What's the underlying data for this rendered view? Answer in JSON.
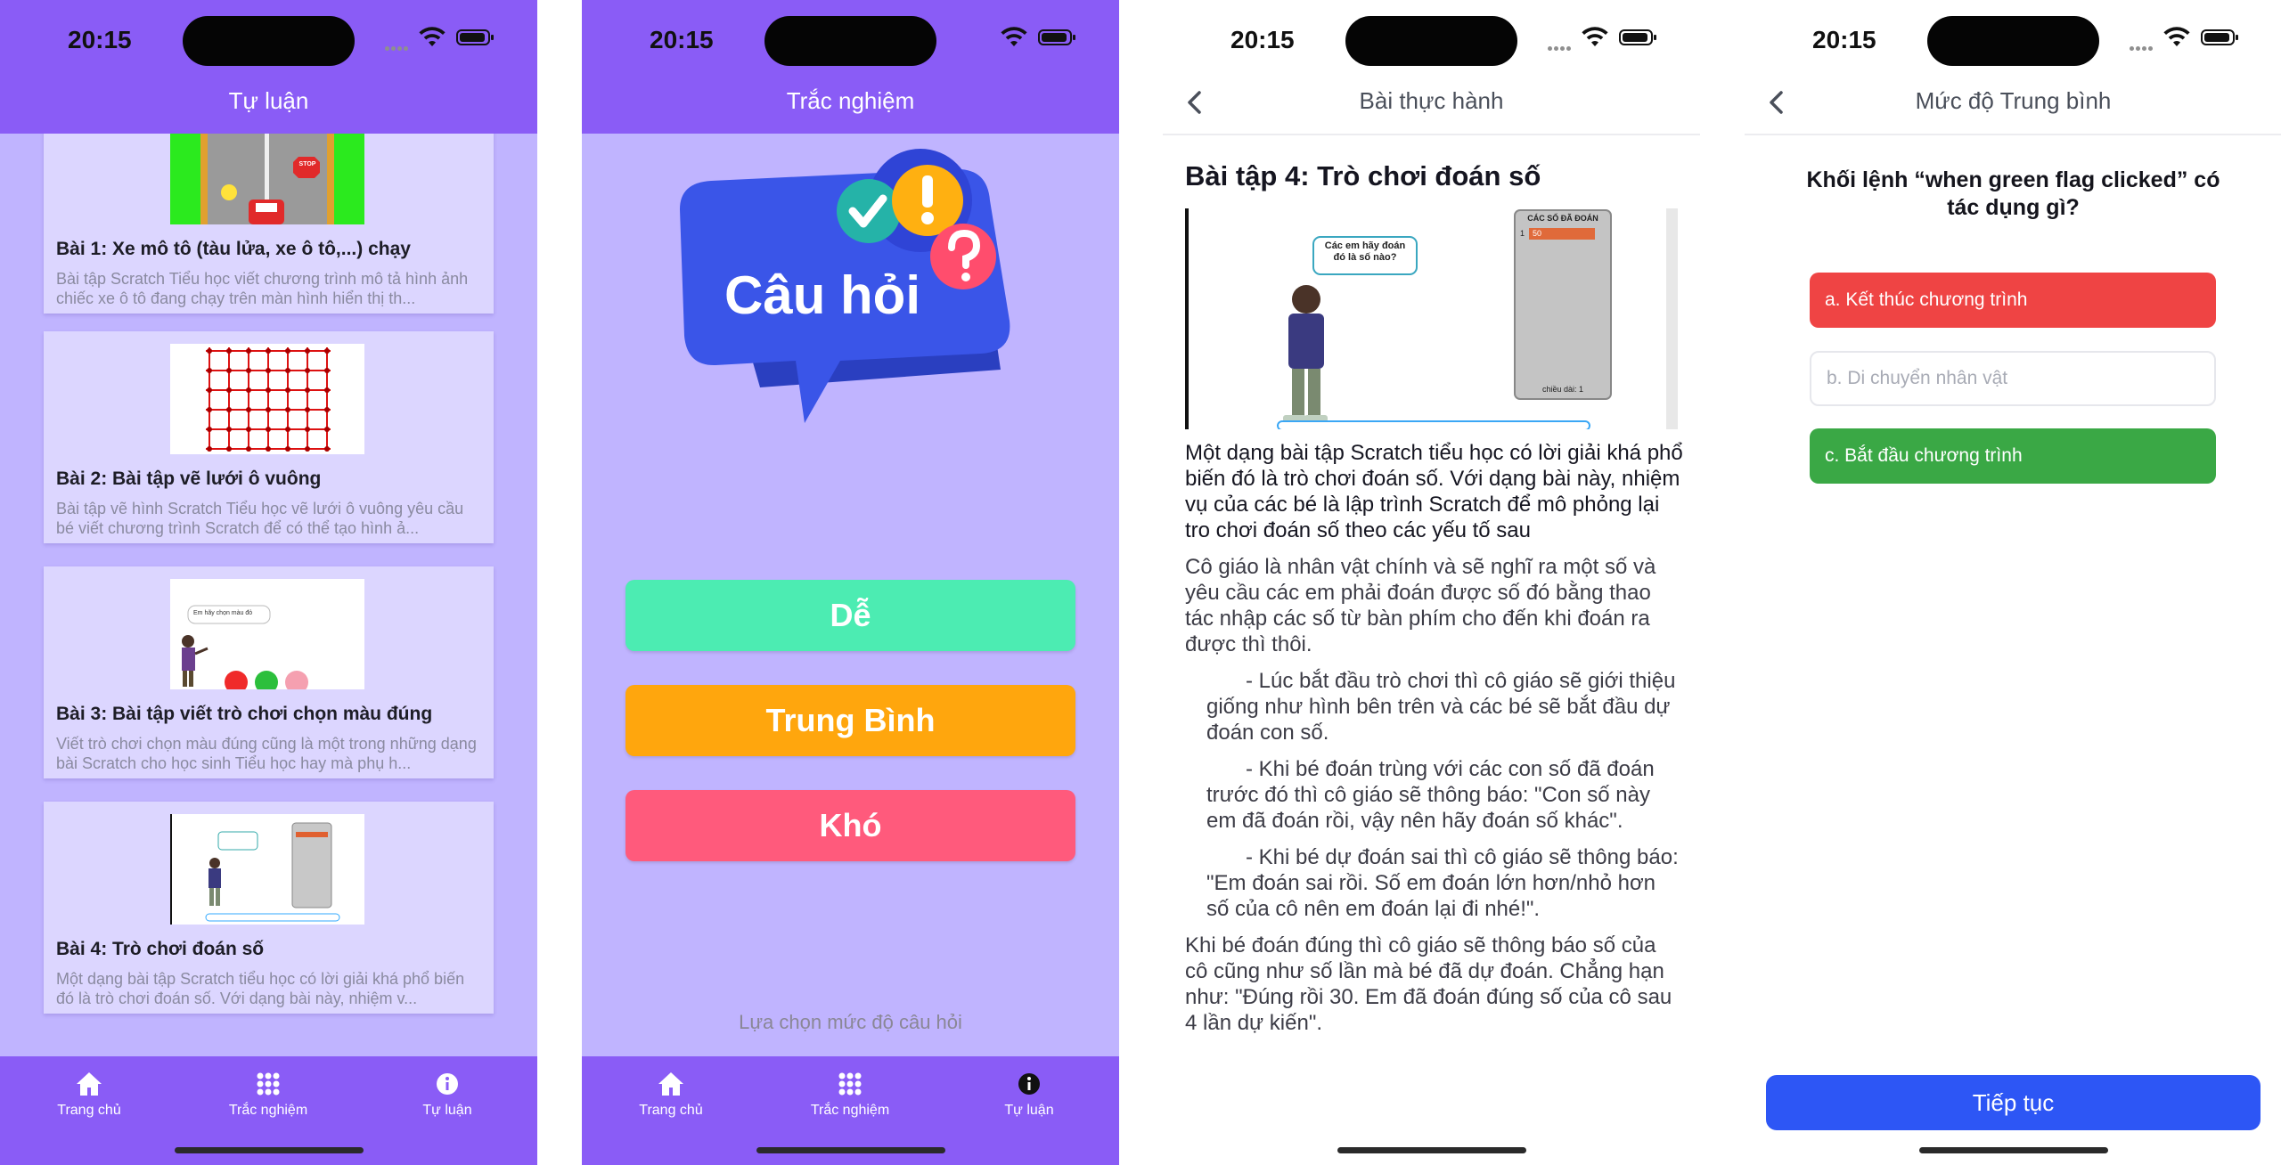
{
  "status": {
    "time": "20:15"
  },
  "screen1": {
    "title": "Tự luận",
    "cards": [
      {
        "title": "Bài 1: Xe mô tô (tàu lửa, xe ô tô,...) chạy",
        "desc": "Bài tập Scratch Tiểu học viết chương trình mô tả hình ảnh chiếc xe ô tô đang chạy trên màn hình hiển thị th...",
        "thumb_sign": "STOP"
      },
      {
        "title": "Bài 2: Bài tập vẽ lưới ô vuông",
        "desc": "Bài tập vẽ hình Scratch Tiểu học vẽ lưới ô vuông yêu cầu bé viết chương trình Scratch để có thể tạo hình ả..."
      },
      {
        "title": "Bài 3: Bài tập viết trò chơi chọn màu đúng",
        "desc": "Viết trò chơi chọn màu đúng cũng là một trong những dạng bài Scratch cho học sinh Tiểu học hay mà phụ h...",
        "thumb_speech": "Em hãy chọn màu đỏ"
      },
      {
        "title": "Bài 4: Trò chơi đoán số",
        "desc": "Một dạng bài tập Scratch tiểu học có lời giải khá phổ biến đó là trò chơi đoán số. Với dạng bài này, nhiệm v..."
      }
    ]
  },
  "tabs": [
    {
      "label": "Trang chủ",
      "icon": "home-icon"
    },
    {
      "label": "Trắc nghiệm",
      "icon": "grid-icon"
    },
    {
      "label": "Tự luận",
      "icon": "info-icon"
    }
  ],
  "screen2": {
    "title": "Trắc nghiệm",
    "bubble_text": "Câu hỏi",
    "levels": [
      {
        "label": "Dễ",
        "color": "#4cecb2"
      },
      {
        "label": "Trung Bình",
        "color": "#ffa60d"
      },
      {
        "label": "Khó",
        "color": "#ff5a7c"
      }
    ],
    "hint": "Lựa chọn mức độ câu hỏi"
  },
  "screen3": {
    "title": "Bài thực hành",
    "heading": "Bài tập 4: Trò chơi đoán số",
    "image": {
      "speech": "Các em hãy đoán đó là số nào?",
      "list_header": "CÁC SỐ ĐÃ ĐOÁN",
      "list_index": "1",
      "list_value": "50",
      "list_footer": "chiều dài: 1"
    },
    "paragraphs": [
      {
        "style": "main",
        "text": "Một dạng bài tập Scratch tiểu học có lời giải khá phổ biến đó là trò chơi đoán số. Với dạng bài này, nhiệm vụ của các bé là lập trình Scratch để mô phỏng lại tro chơi đoán số theo các yếu tố sau"
      },
      {
        "style": "grey",
        "text": "Cô giáo là nhân vật chính và sẽ nghĩ ra một số và yêu cầu các em phải đoán được số đó bằng thao tác nhập các số từ bàn phím cho đến khi đoán ra được thì thôi."
      },
      {
        "style": "ind",
        "text": "- Lúc bắt đầu trò chơi thì cô giáo sẽ giới thiệu giống như hình bên trên và các bé sẽ bắt đầu dự đoán con số."
      },
      {
        "style": "ind",
        "text": "- Khi bé đoán trùng với các con số đã đoán trước đó thì cô giáo sẽ thông báo: \"Con số này em đã đoán rồi, vậy nên hãy đoán số khác\"."
      },
      {
        "style": "ind",
        "text": "- Khi bé dự đoán sai thì cô giáo sẽ thông báo: \"Em đoán sai rồi. Số em đoán lớn hơn/nhỏ hơn số của cô nên em đoán lại đi nhé!\"."
      },
      {
        "style": "grey",
        "text": "Khi bé đoán đúng thì cô giáo sẽ thông báo số của cô cũng như số lần mà bé đã dự đoán. Chẳng hạn như: \"Đúng rồi 30. Em đã đoán đúng số của cô sau 4 lần dự kiến\"."
      }
    ]
  },
  "screen4": {
    "title": "Mức độ Trung bình",
    "question": "Khối lệnh “when green flag clicked” có tác dụng gì?",
    "answers": [
      {
        "label": "a. Kết thúc chương trình",
        "state": "wrong"
      },
      {
        "label": "b. Di chuyển nhân vật",
        "state": "neutral"
      },
      {
        "label": "c. Bắt đầu chương trình",
        "state": "correct"
      }
    ],
    "continue_label": "Tiếp tục"
  }
}
